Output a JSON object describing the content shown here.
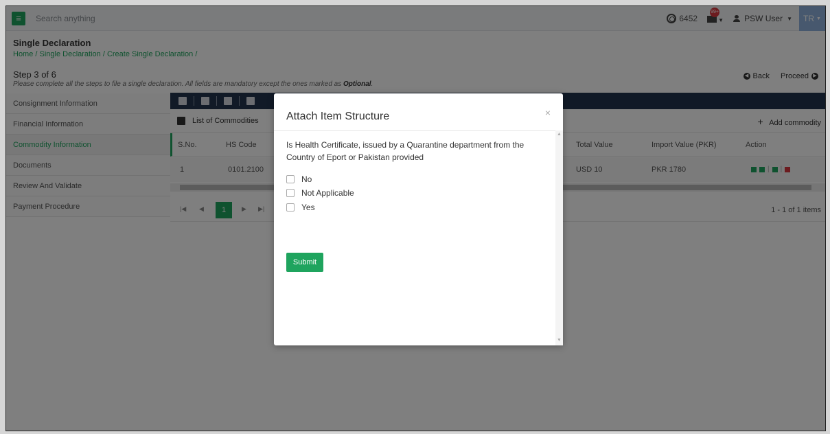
{
  "topbar": {
    "search_placeholder": "Search anything",
    "credit_balance": "6452",
    "mail_badge": "99+",
    "user_name": "PSW User",
    "language": "TR"
  },
  "header": {
    "title": "Single Declaration",
    "breadcrumb": "Home / Single Declaration / Create Single Declaration /",
    "step_title": "Step 3 of 6",
    "step_desc": "Please complete all the steps to file a single declaration. All fields are mandatory except the ones marked as",
    "step_desc_bold": "Optional",
    "back_label": "Back",
    "proceed_label": "Proceed"
  },
  "sidebar": {
    "items": [
      {
        "label": "Consignment Information"
      },
      {
        "label": "Financial Information"
      },
      {
        "label": "Commodity Information"
      },
      {
        "label": "Documents"
      },
      {
        "label": "Review And Validate"
      },
      {
        "label": "Payment Procedure"
      }
    ]
  },
  "main": {
    "list_title": "List of Commodities",
    "add_commodity": "Add commodity",
    "columns": [
      "S.No.",
      "HS Code",
      "Total Value",
      "Import Value (PKR)",
      "Action"
    ],
    "rows": [
      {
        "sno": "1",
        "hs_code": "0101.2100",
        "total_value": "USD 10",
        "import_value": "PKR 1780"
      }
    ],
    "pager": {
      "current_page": "1",
      "info": "1 - 1 of 1 items"
    }
  },
  "modal": {
    "title": "Attach Item Structure",
    "close": "×",
    "question": "Is Health Certificate, issued by a Quarantine department from the Country of Eport or Pakistan provided",
    "options": [
      {
        "label": "No"
      },
      {
        "label": "Not Applicable"
      },
      {
        "label": "Yes"
      }
    ],
    "submit_label": "Submit"
  },
  "colors": {
    "accent": "#1fa45e",
    "toolbar": "#23344f",
    "language_bg": "#8fb0dc"
  }
}
